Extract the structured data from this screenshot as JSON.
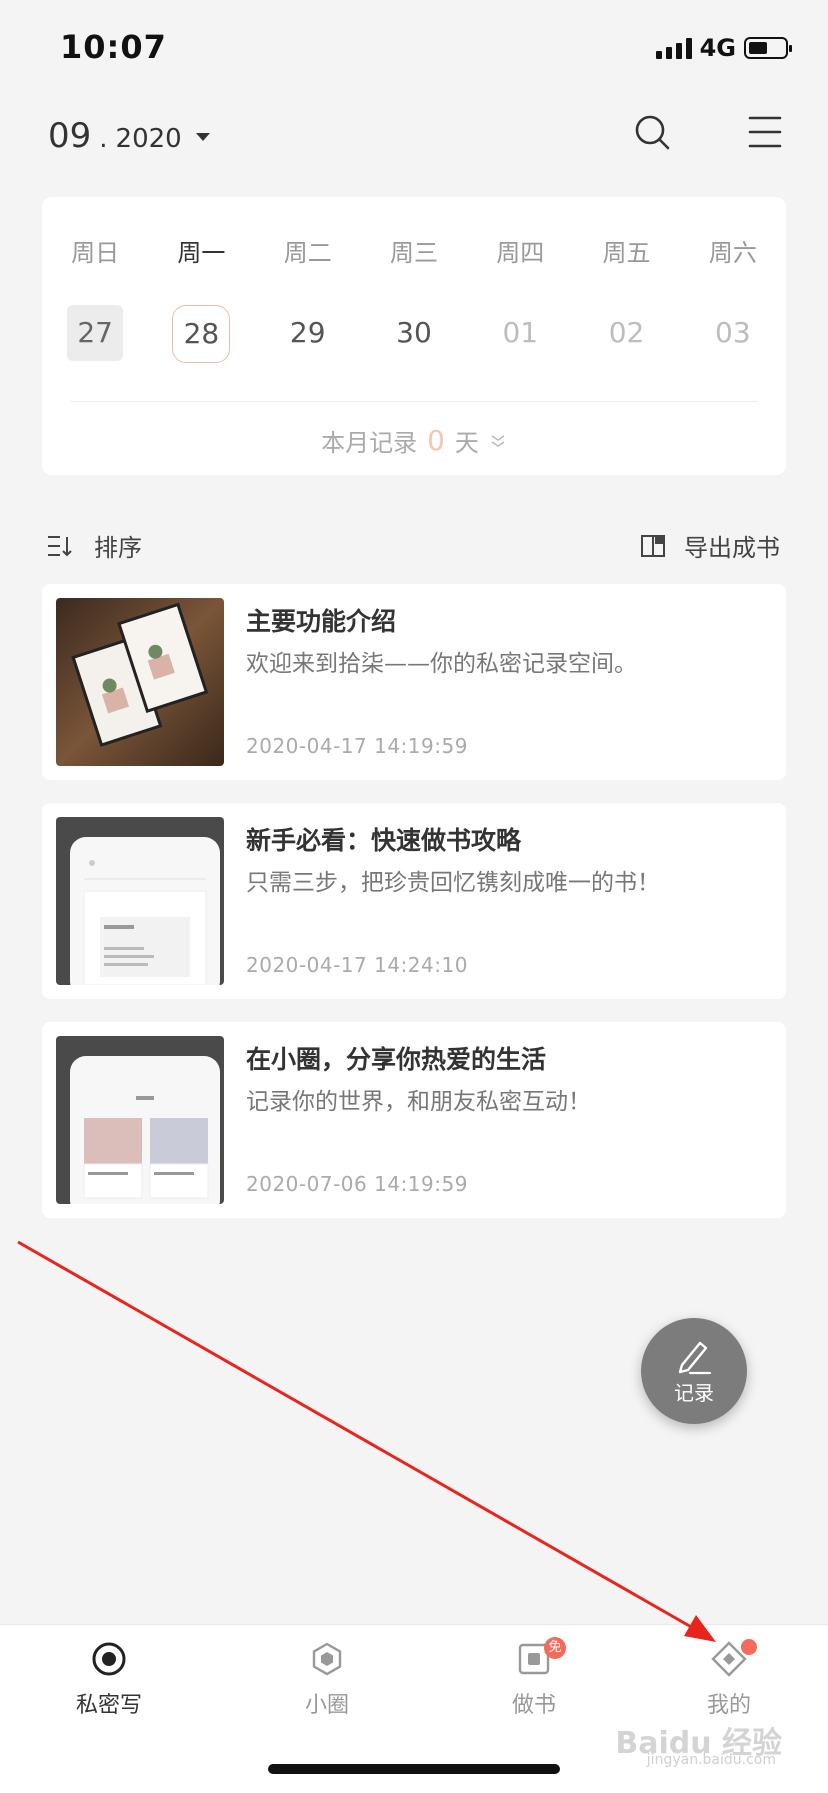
{
  "status_bar": {
    "time": "10:07",
    "network": "4G"
  },
  "header": {
    "month": "09",
    "sep": ".",
    "year": "2020"
  },
  "calendar": {
    "weekdays": [
      "周日",
      "周一",
      "周二",
      "周三",
      "周四",
      "周五",
      "周六"
    ],
    "dates": [
      "27",
      "28",
      "29",
      "30",
      "01",
      "02",
      "03"
    ],
    "summary_prefix": "本月记录",
    "summary_count": "0",
    "summary_suffix": "天"
  },
  "toolbar": {
    "sort_label": "排序",
    "export_label": "导出成书"
  },
  "entries": [
    {
      "title": "主要功能介绍",
      "subtitle": "欢迎来到拾柒——你的私密记录空间。",
      "date": "2020-04-17 14:19:59"
    },
    {
      "title": "新手必看：快速做书攻略",
      "subtitle": "只需三步，把珍贵回忆镌刻成唯一的书！",
      "date": "2020-04-17 14:24:10"
    },
    {
      "title": "在小圈，分享你热爱的生活",
      "subtitle": "记录你的世界，和朋友私密互动！",
      "date": "2020-07-06 14:19:59"
    }
  ],
  "fab": {
    "label": "记录"
  },
  "tabbar": {
    "items": [
      {
        "label": "私密写",
        "icon": "record-circle-icon"
      },
      {
        "label": "小圈",
        "icon": "hexagon-icon"
      },
      {
        "label": "做书",
        "icon": "book-icon",
        "badge": "免"
      },
      {
        "label": "我的",
        "icon": "diamond-icon"
      }
    ]
  },
  "watermark": {
    "text": "Baidu 经验",
    "sub": "jingyan.baidu.com"
  },
  "colors": {
    "accent": "#f26b5b",
    "today_ring": "#e6bfa8",
    "count_color": "#f4c7b0",
    "annotation": "#e8241c"
  }
}
